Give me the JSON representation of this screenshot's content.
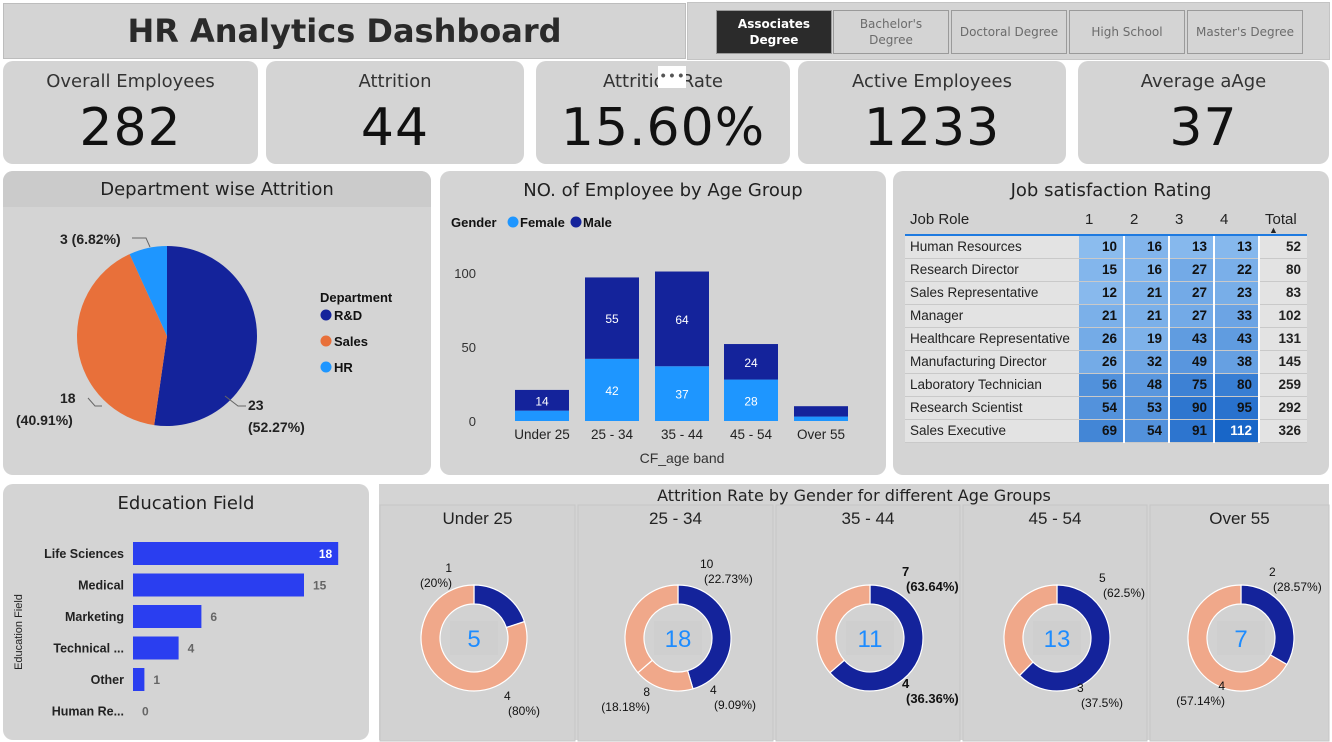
{
  "header": {
    "title": "HR Analytics Dashboard"
  },
  "slicer": {
    "options": [
      {
        "label": "Associates Degree",
        "selected": true
      },
      {
        "label": "Bachelor's Degree",
        "selected": false
      },
      {
        "label": "Doctoral Degree",
        "selected": false
      },
      {
        "label": "High School",
        "selected": false
      },
      {
        "label": "Master's Degree",
        "selected": false
      }
    ]
  },
  "more_icon": "• • •",
  "kpis": [
    {
      "label": "Overall Employees",
      "value": "282"
    },
    {
      "label": "Attrition",
      "value": "44"
    },
    {
      "label": "Attrition Rate",
      "value": "15.60%"
    },
    {
      "label": "Active Employees",
      "value": "1233"
    },
    {
      "label": "Average aAge",
      "value": "37"
    }
  ],
  "colors": {
    "dark_blue": "#14239b",
    "light_blue": "#1e96ff",
    "orange": "#e8703a",
    "peach": "#f0a88a",
    "panel": "#d4d4d4"
  },
  "chart_data": [
    {
      "type": "pie",
      "title": "Department wise Attrition",
      "legend_title": "Department",
      "legend_position": "right",
      "categories": [
        "R&D",
        "Sales",
        "HR"
      ],
      "values": [
        23,
        18,
        3
      ],
      "labels": [
        "23 (52.27%)",
        "18 (40.91%)",
        "3 (6.82%)"
      ],
      "colors": [
        "#14239b",
        "#e8703a",
        "#1e96ff"
      ]
    },
    {
      "type": "bar",
      "title": "NO. of Employee by Age Group",
      "legend_title": "Gender",
      "xlabel": "CF_age band",
      "ylabel": "",
      "ylim": [
        0,
        110
      ],
      "yticks": [
        0,
        50,
        100
      ],
      "categories": [
        "Under 25",
        "25 - 34",
        "35 - 44",
        "45 - 54",
        "Over 55"
      ],
      "series": [
        {
          "name": "Female",
          "color": "#1e96ff",
          "values": [
            7,
            42,
            37,
            28,
            3
          ],
          "labels": [
            "",
            "42",
            "37",
            "28",
            ""
          ]
        },
        {
          "name": "Male",
          "color": "#14239b",
          "values": [
            14,
            55,
            64,
            24,
            7
          ],
          "labels": [
            "14",
            "55",
            "64",
            "24",
            ""
          ]
        }
      ]
    },
    {
      "type": "table",
      "title": "Job satisfaction Rating",
      "columns": [
        "Job Role",
        "1",
        "2",
        "3",
        "4",
        "Total"
      ],
      "sort_indicator": "▲",
      "rows": [
        {
          "role": "Human Resources",
          "values": [
            10,
            16,
            13,
            13
          ],
          "total": 52
        },
        {
          "role": "Research Director",
          "values": [
            15,
            16,
            27,
            22
          ],
          "total": 80
        },
        {
          "role": "Sales Representative",
          "values": [
            12,
            21,
            27,
            23
          ],
          "total": 83
        },
        {
          "role": "Manager",
          "values": [
            21,
            21,
            27,
            33
          ],
          "total": 102
        },
        {
          "role": "Healthcare Representative",
          "values": [
            26,
            19,
            43,
            43
          ],
          "total": 131
        },
        {
          "role": "Manufacturing Director",
          "values": [
            26,
            32,
            49,
            38
          ],
          "total": 145
        },
        {
          "role": "Laboratory Technician",
          "values": [
            56,
            48,
            75,
            80
          ],
          "total": 259
        },
        {
          "role": "Research Scientist",
          "values": [
            54,
            53,
            90,
            95
          ],
          "total": 292
        },
        {
          "role": "Sales Executive",
          "values": [
            69,
            54,
            91,
            112
          ],
          "total": 326
        }
      ]
    },
    {
      "type": "bar",
      "orientation": "horizontal",
      "title": "Education Field",
      "ylabel": "Education Field",
      "color": "#2a3ef0",
      "categories": [
        "Life Sciences",
        "Medical",
        "Marketing",
        "Technical ...",
        "Other",
        "Human Re..."
      ],
      "values": [
        18,
        15,
        6,
        4,
        1,
        0
      ]
    },
    {
      "type": "pie",
      "subtype": "donut",
      "title": "Attrition Rate by Gender for different Age Groups",
      "groups": [
        {
          "name": "Under 25",
          "total": "5",
          "segments": [
            {
              "value": 1,
              "label_count": "1",
              "label_pct": "(20%)",
              "color": "#14239b"
            },
            {
              "value": 4,
              "label_count": "4",
              "label_pct": "(80%)",
              "color": "#f0a88a"
            }
          ]
        },
        {
          "name": "25 - 34",
          "total": "18",
          "segments": [
            {
              "value": 10,
              "label_count": "10",
              "label_pct": "(22.73%)",
              "color": "#14239b"
            },
            {
              "value": 4,
              "label_count": "4",
              "label_pct": "(9.09%)",
              "color": "#f0a88a"
            },
            {
              "value": 8,
              "label_count": "8",
              "label_pct": "(18.18%)",
              "color": "#f0a88a"
            }
          ]
        },
        {
          "name": "35 - 44",
          "total": "11",
          "segments": [
            {
              "value": 7,
              "label_count": "7",
              "label_pct": "(63.64%)",
              "color": "#14239b"
            },
            {
              "value": 4,
              "label_count": "4",
              "label_pct": "(36.36%)",
              "color": "#f0a88a"
            }
          ]
        },
        {
          "name": "45 - 54",
          "total": "13",
          "segments": [
            {
              "value": 5,
              "label_count": "5",
              "label_pct": "(62.5%)",
              "color": "#14239b"
            },
            {
              "value": 3,
              "label_count": "3",
              "label_pct": "(37.5%)",
              "color": "#f0a88a"
            }
          ]
        },
        {
          "name": "Over 55",
          "total": "7",
          "segments": [
            {
              "value": 2,
              "label_count": "2",
              "label_pct": "(28.57%)",
              "color": "#14239b"
            },
            {
              "value": 4,
              "label_count": "4",
              "label_pct": "(57.14%)",
              "color": "#f0a88a"
            }
          ]
        }
      ]
    }
  ]
}
